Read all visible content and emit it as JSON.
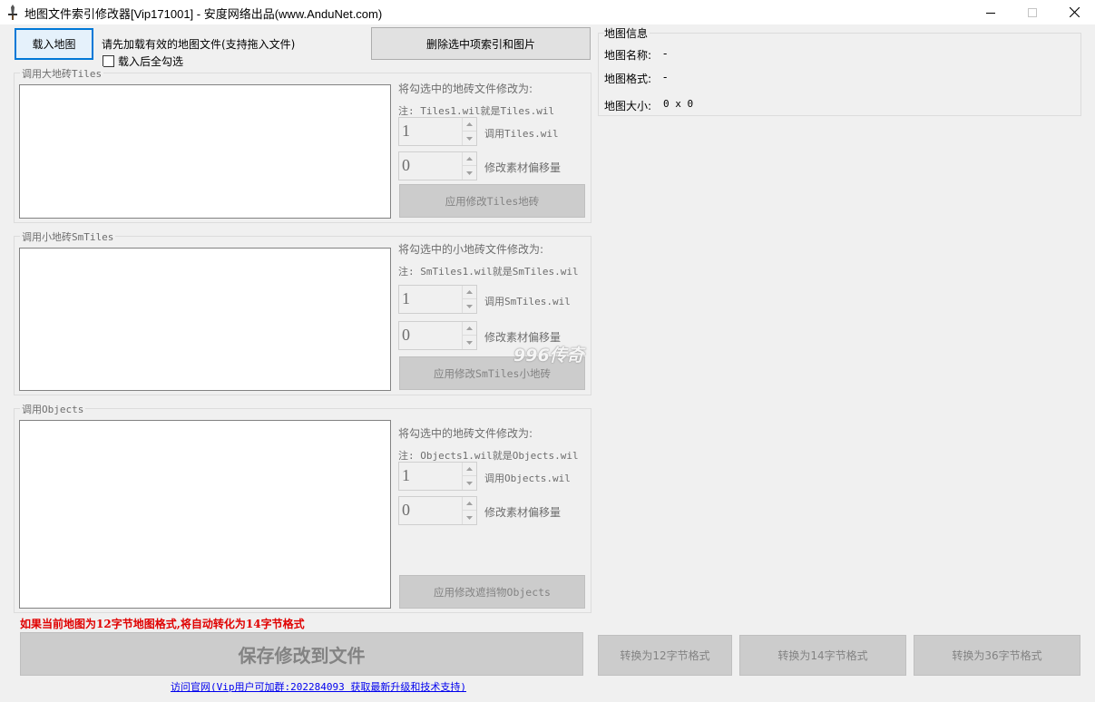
{
  "window": {
    "title": "地图文件索引修改器[Vip171001] - 安度网络出品(www.AnduNet.com)",
    "icon": "sword-icon"
  },
  "top": {
    "load_button": "载入地图",
    "hint": "请先加载有效的地图文件(支持拖入文件)",
    "select_all_after_load": "载入后全勾选",
    "delete_button": "删除选中项索引和图片"
  },
  "tiles": {
    "group_title": "调用大地砖Tiles",
    "modify_label": "将勾选中的地砖文件修改为:",
    "note": "注: Tiles1.wil就是Tiles.wil",
    "index_value": "1",
    "index_label": "调用Tiles.wil",
    "offset_value": "0",
    "offset_label": "修改素材偏移量",
    "apply_button": "应用修改Tiles地砖"
  },
  "smtiles": {
    "group_title": "调用小地砖SmTiles",
    "modify_label": "将勾选中的小地砖文件修改为:",
    "note": "注: SmTiles1.wil就是SmTiles.wil",
    "index_value": "1",
    "index_label": "调用SmTiles.wil",
    "offset_value": "0",
    "offset_label": "修改素材偏移量",
    "apply_button": "应用修改SmTiles小地砖"
  },
  "objects": {
    "group_title": "调用Objects",
    "modify_label": "将勾选中的地砖文件修改为:",
    "note": "注: Objects1.wil就是Objects.wil",
    "index_value": "1",
    "index_label": "调用Objects.wil",
    "offset_value": "0",
    "offset_label": "修改素材偏移量",
    "apply_button": "应用修改遮挡物Objects"
  },
  "map_info": {
    "title": "地图信息",
    "name_label": "地图名称:",
    "name_value": "-",
    "format_label": "地图格式:",
    "format_value": "-",
    "size_label": "地图大小:",
    "size_value": "0 x 0"
  },
  "bottom": {
    "warning": "如果当前地图为12字节地图格式,将自动转化为14字节格式",
    "save_button": "保存修改到文件",
    "convert12": "转换为12字节格式",
    "convert14": "转换为14字节格式",
    "convert36": "转换为36字节格式",
    "website_link": "访问官网(Vip用户可加群:202284093 获取最新升级和技术支持)"
  },
  "watermark": "996传奇",
  "colors": {
    "accent": "#0078d7",
    "warning": "#e00000",
    "link": "#0000ee",
    "disabled_bg": "#cccccc"
  }
}
